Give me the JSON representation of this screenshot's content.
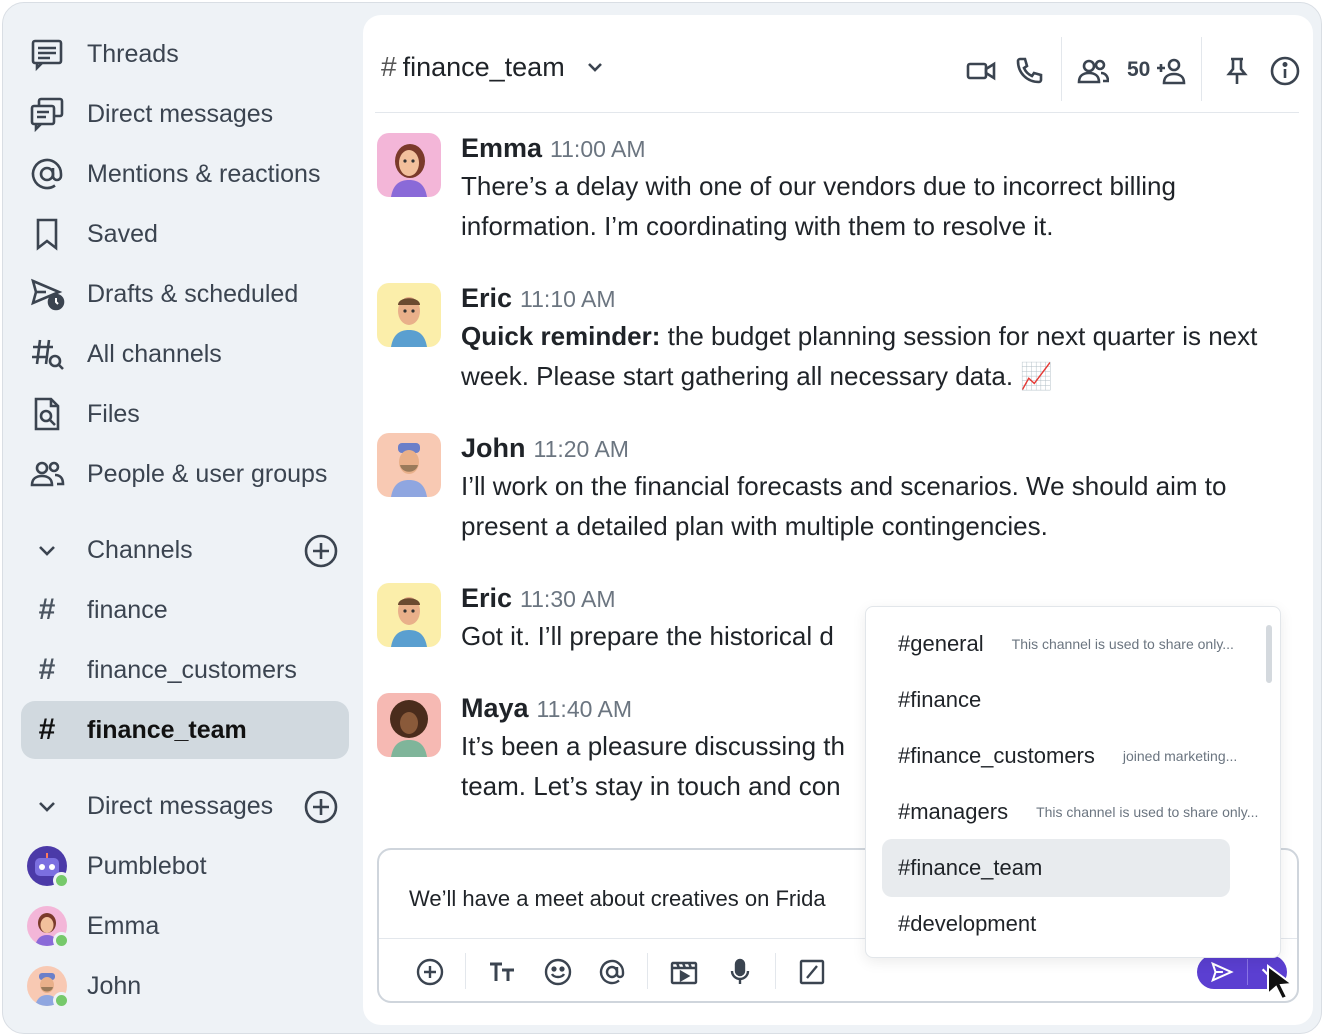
{
  "sidebar": {
    "nav": [
      {
        "label": "Threads",
        "icon": "threads-icon"
      },
      {
        "label": "Direct messages",
        "icon": "direct-messages-icon"
      },
      {
        "label": "Mentions & reactions",
        "icon": "at-icon"
      },
      {
        "label": "Saved",
        "icon": "bookmark-icon"
      },
      {
        "label": "Drafts & scheduled",
        "icon": "send-clock-icon"
      },
      {
        "label": "All channels",
        "icon": "hash-search-icon"
      },
      {
        "label": "Files",
        "icon": "file-search-icon"
      },
      {
        "label": "People & user groups",
        "icon": "people-icon"
      }
    ],
    "channels_header": "Channels",
    "channels": [
      "finance",
      "finance_customers",
      "finance_team"
    ],
    "active_channel": "finance_team",
    "dm_header": "Direct messages",
    "dms": [
      {
        "name": "Pumblebot",
        "status": "online"
      },
      {
        "name": "Emma",
        "status": "online"
      },
      {
        "name": "John",
        "status": "online"
      }
    ]
  },
  "header": {
    "channel_name": "finance_team",
    "member_count": "50"
  },
  "messages": [
    {
      "author": "Emma",
      "time": "11:00 AM",
      "bold": "",
      "text": "There’s a delay with one of our vendors due to incorrect billing information. I’m coordinating with them to resolve it."
    },
    {
      "author": "Eric",
      "time": "11:10 AM",
      "bold": "Quick reminder:",
      "text": " the budget planning session for next quarter is next week. Please start gathering all necessary data. 📈"
    },
    {
      "author": "John",
      "time": "11:20 AM",
      "bold": "",
      "text": "I’ll work on the financial forecasts and scenarios. We should aim to present a detailed plan with multiple contingencies."
    },
    {
      "author": "Eric",
      "time": "11:30 AM",
      "bold": "",
      "text": "Got it. I’ll prepare the historical d"
    },
    {
      "author": "Maya",
      "time": "11:40 AM",
      "bold": "",
      "text": "It’s been a pleasure discussing th team. Let’s stay in touch and con"
    }
  ],
  "composer": {
    "value": "We’ll have a meet about creatives  on Frida"
  },
  "channel_suggestions": [
    {
      "name": "#general",
      "desc": "This channel is used to share only..."
    },
    {
      "name": "#finance",
      "desc": ""
    },
    {
      "name": "#finance_customers",
      "desc": "joined marketing..."
    },
    {
      "name": "#managers",
      "desc": "This channel is used to share only..."
    },
    {
      "name": "#finance_team",
      "desc": ""
    },
    {
      "name": "#development",
      "desc": ""
    }
  ],
  "colors": {
    "accent": "#5b3fd1",
    "online": "#76c96b",
    "sidebar_bg": "#eef2f6",
    "active_bg": "#d1d9df"
  }
}
